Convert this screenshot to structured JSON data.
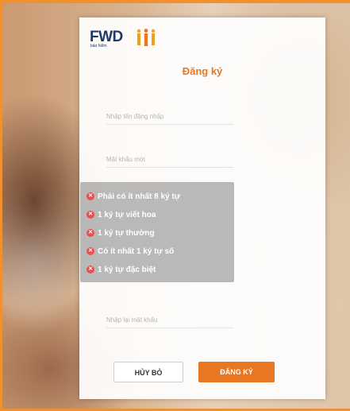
{
  "brand": {
    "logo_text": "FWD",
    "logo_sub": "bảo hiểm",
    "accent_color": "#e87722"
  },
  "form": {
    "title": "Đăng ký",
    "username_placeholder": "Nhập tên đăng nhập",
    "new_password_placeholder": "Mật khẩu mới",
    "confirm_password_placeholder": "Nhập lại mật khẩu"
  },
  "password_rules": [
    {
      "text": "Phải có ít nhất 8 ký tự",
      "status": "invalid"
    },
    {
      "text": "1 ký tự viết hoa",
      "status": "invalid"
    },
    {
      "text": "1 ký tự thường",
      "status": "invalid"
    },
    {
      "text": "Có ít nhất 1 ký tự số",
      "status": "invalid"
    },
    {
      "text": "1 ký tự đặc biệt",
      "status": "invalid"
    }
  ],
  "buttons": {
    "cancel": "HỦY BỎ",
    "submit": "ĐĂNG KÝ"
  }
}
